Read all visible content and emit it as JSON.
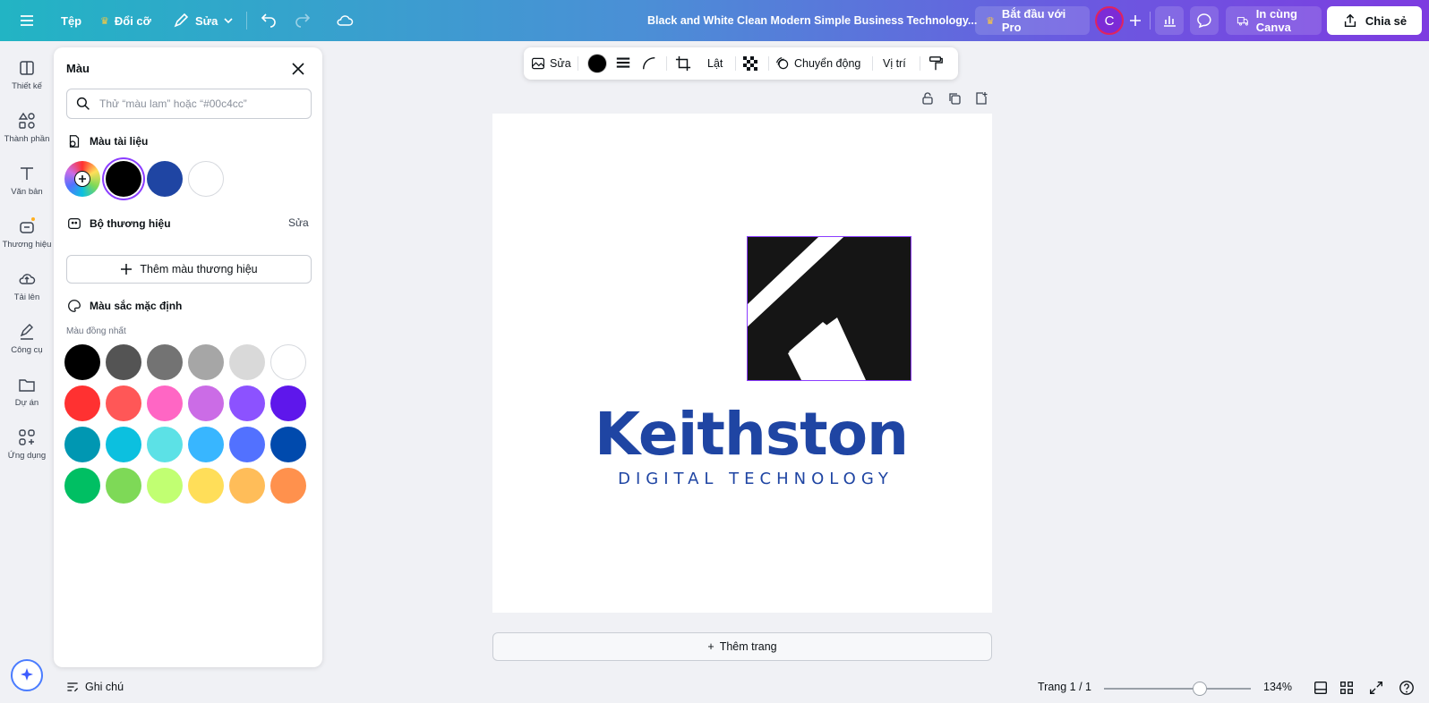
{
  "topbar": {
    "file_label": "Tệp",
    "resize_label": "Đổi cỡ",
    "edit_label": "Sửa",
    "doc_title": "Black and White Clean Modern Simple Business Technology...",
    "pro_label": "Bắt đầu với Pro",
    "avatar_initial": "C",
    "print_label": "In cùng Canva",
    "share_label": "Chia sẻ"
  },
  "rail": {
    "items": [
      {
        "label": "Thiết kế",
        "icon": "design-icon"
      },
      {
        "label": "Thành phần",
        "icon": "elements-icon"
      },
      {
        "label": "Văn bản",
        "icon": "text-icon"
      },
      {
        "label": "Thương hiệu",
        "icon": "brand-icon"
      },
      {
        "label": "Tải lên",
        "icon": "upload-icon"
      },
      {
        "label": "Công cụ",
        "icon": "draw-icon"
      },
      {
        "label": "Dự án",
        "icon": "folder-icon"
      },
      {
        "label": "Ứng dụng",
        "icon": "apps-icon"
      }
    ]
  },
  "color_panel": {
    "title": "Màu",
    "search_placeholder": "Thử “màu lam” hoặc “#00c4cc”",
    "doc_colors_heading": "Màu tài liệu",
    "doc_colors": [
      "#000000",
      "#1f45a3",
      "#ffffff"
    ],
    "brand_kit_heading": "Bộ thương hiệu",
    "brand_kit_edit": "Sửa",
    "add_brand_color": "Thêm màu thương hiệu",
    "default_colors_heading": "Màu sắc mặc định",
    "solid_colors_label": "Màu đồng nhất",
    "solid_colors": [
      [
        "#000000",
        "#545454",
        "#737373",
        "#a6a6a6",
        "#d9d9d9",
        "#ffffff"
      ],
      [
        "#ff3131",
        "#ff5757",
        "#ff66c4",
        "#cb6ce6",
        "#8c52ff",
        "#5e17eb"
      ],
      [
        "#0097b2",
        "#0cc0df",
        "#5ce1e6",
        "#38b6ff",
        "#5271ff",
        "#004aad"
      ],
      [
        "#00bf63",
        "#7ed957",
        "#c1ff72",
        "#ffde59",
        "#ffbd59",
        "#ff914d"
      ]
    ]
  },
  "context_toolbar": {
    "edit_label": "Sửa",
    "flip_label": "Lật",
    "animate_label": "Chuyển động",
    "position_label": "Vị trí",
    "fill_color": "#000000"
  },
  "canvas": {
    "brand_name": "Keithston",
    "tagline": "DIGITAL TECHNOLOGY",
    "brand_color": "#1f45a3",
    "add_page_label": "Thêm trang"
  },
  "footer": {
    "notes_label": "Ghi chú",
    "page_indicator": "Trang 1 / 1",
    "zoom_label": "134%",
    "zoom_fraction": 0.65
  }
}
